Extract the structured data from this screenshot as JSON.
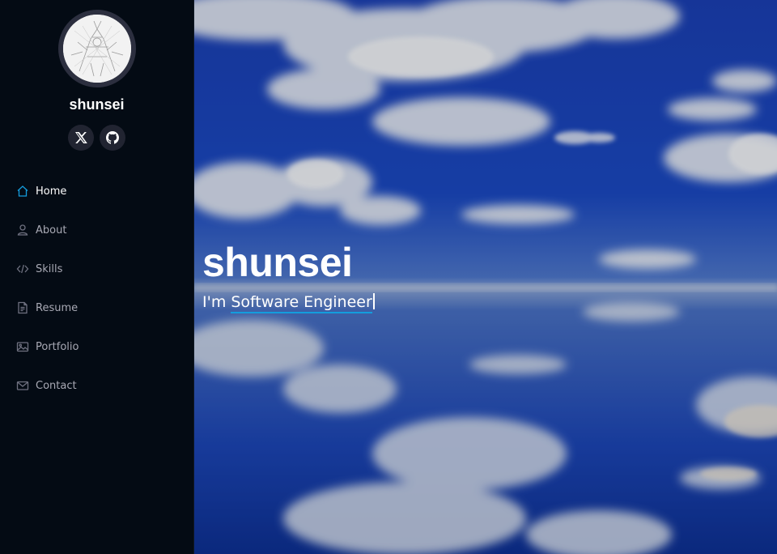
{
  "profile": {
    "name": "shunsei"
  },
  "social": [
    {
      "icon": "x-twitter-icon"
    },
    {
      "icon": "github-icon"
    }
  ],
  "nav": {
    "items": [
      {
        "label": "Home",
        "icon": "house-icon",
        "active": true
      },
      {
        "label": "About",
        "icon": "person-icon",
        "active": false
      },
      {
        "label": "Skills",
        "icon": "code-icon",
        "active": false
      },
      {
        "label": "Resume",
        "icon": "file-text-icon",
        "active": false
      },
      {
        "label": "Portfolio",
        "icon": "images-icon",
        "active": false
      },
      {
        "label": "Contact",
        "icon": "envelope-icon",
        "active": false
      }
    ]
  },
  "hero": {
    "title": "shunsei",
    "prefix": "I'm ",
    "typed": "Software Engineer"
  },
  "colors": {
    "sidebar_bg": "#040b14",
    "accent": "#149ddd",
    "nav_text": "#a8a9b4"
  }
}
